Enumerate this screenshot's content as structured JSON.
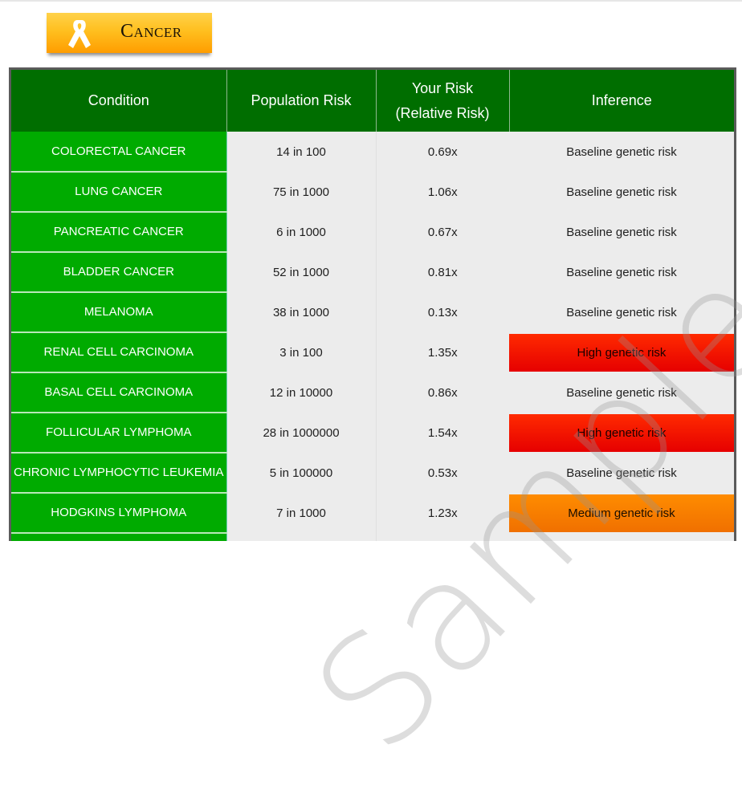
{
  "section": {
    "title": "Cancer",
    "icon": "awareness-ribbon-icon"
  },
  "watermark": "Sample Report",
  "colors": {
    "header_bg": "#006e00",
    "condition_bg": "#00ab00",
    "high_risk": "#ff1a00",
    "medium_risk": "#ff8400",
    "badge": "#ffb400"
  },
  "table": {
    "headers": {
      "condition": "Condition",
      "population_risk": "Population Risk",
      "your_risk_line1": "Your Risk",
      "your_risk_line2": "(Relative Risk)",
      "inference": "Inference"
    },
    "rows": [
      {
        "condition": "COLORECTAL CANCER",
        "population_risk": "14 in 100",
        "relative_risk": "0.69x",
        "inference": "Baseline genetic risk",
        "level": "baseline"
      },
      {
        "condition": "LUNG CANCER",
        "population_risk": "75 in 1000",
        "relative_risk": "1.06x",
        "inference": "Baseline genetic risk",
        "level": "baseline"
      },
      {
        "condition": "PANCREATIC CANCER",
        "population_risk": "6 in 1000",
        "relative_risk": "0.67x",
        "inference": "Baseline genetic risk",
        "level": "baseline"
      },
      {
        "condition": "BLADDER CANCER",
        "population_risk": "52 in 1000",
        "relative_risk": "0.81x",
        "inference": "Baseline genetic risk",
        "level": "baseline"
      },
      {
        "condition": "MELANOMA",
        "population_risk": "38 in 1000",
        "relative_risk": "0.13x",
        "inference": "Baseline genetic risk",
        "level": "baseline"
      },
      {
        "condition": "RENAL CELL CARCINOMA",
        "population_risk": "3 in 100",
        "relative_risk": "1.35x",
        "inference": "High genetic risk",
        "level": "high"
      },
      {
        "condition": "BASAL CELL CARCINOMA",
        "population_risk": "12 in 10000",
        "relative_risk": "0.86x",
        "inference": "Baseline genetic risk",
        "level": "baseline"
      },
      {
        "condition": "FOLLICULAR LYMPHOMA",
        "population_risk": "28 in 1000000",
        "relative_risk": "1.54x",
        "inference": "High genetic risk",
        "level": "high"
      },
      {
        "condition": "CHRONIC LYMPHOCYTIC LEUKEMIA",
        "population_risk": "5 in 100000",
        "relative_risk": "0.53x",
        "inference": "Baseline genetic risk",
        "level": "baseline"
      },
      {
        "condition": "HODGKINS LYMPHOMA",
        "population_risk": "7 in 1000",
        "relative_risk": "1.23x",
        "inference": "Medium genetic risk",
        "level": "medium"
      },
      {
        "condition": "",
        "population_risk": "",
        "relative_risk": "",
        "inference": "",
        "level": "baseline"
      }
    ]
  }
}
